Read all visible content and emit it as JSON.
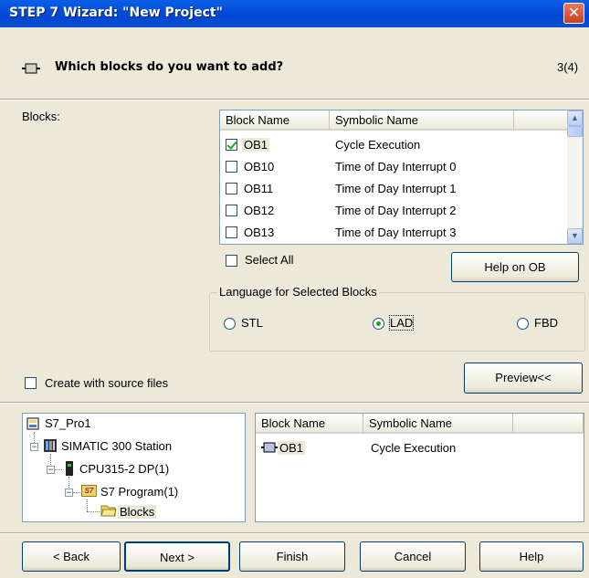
{
  "window": {
    "title": "STEP 7 Wizard: \"New Project\"",
    "close_label": "✕"
  },
  "header": {
    "question": "Which blocks do you want to add?",
    "step": "3(4)"
  },
  "blocks_label": "Blocks:",
  "blocks_table": {
    "columns": [
      "Block Name",
      "Symbolic Name"
    ],
    "rows": [
      {
        "name": "OB1",
        "symbol": "Cycle Execution",
        "checked": true
      },
      {
        "name": "OB10",
        "symbol": "Time of Day Interrupt 0",
        "checked": false
      },
      {
        "name": "OB11",
        "symbol": "Time of Day Interrupt 1",
        "checked": false
      },
      {
        "name": "OB12",
        "symbol": "Time of Day Interrupt 2",
        "checked": false
      },
      {
        "name": "OB13",
        "symbol": "Time of Day Interrupt 3",
        "checked": false
      }
    ]
  },
  "select_all_label": "Select All",
  "help_ob_label": "Help on OB",
  "language": {
    "title": "Language for Selected Blocks",
    "options": [
      "STL",
      "LAD",
      "FBD"
    ],
    "selected": "LAD"
  },
  "source_files_label": "Create with source files",
  "preview_label": "Preview<<",
  "tree": {
    "project": "S7_Pro1",
    "station": "SIMATIC 300 Station",
    "cpu": "CPU315-2 DP(1)",
    "program": "S7 Program(1)",
    "blocks": "Blocks"
  },
  "preview_table": {
    "columns": [
      "Block Name",
      "Symbolic Name"
    ],
    "rows": [
      {
        "name": "OB1",
        "symbol": "Cycle Execution"
      }
    ]
  },
  "buttons": {
    "back": "< Back",
    "next": "Next >",
    "finish": "Finish",
    "cancel": "Cancel",
    "help": "Help"
  },
  "colors": {
    "titlebar": "#0046d5",
    "face": "#ece9d8",
    "check": "#21a121",
    "border": "#7f9db9"
  }
}
